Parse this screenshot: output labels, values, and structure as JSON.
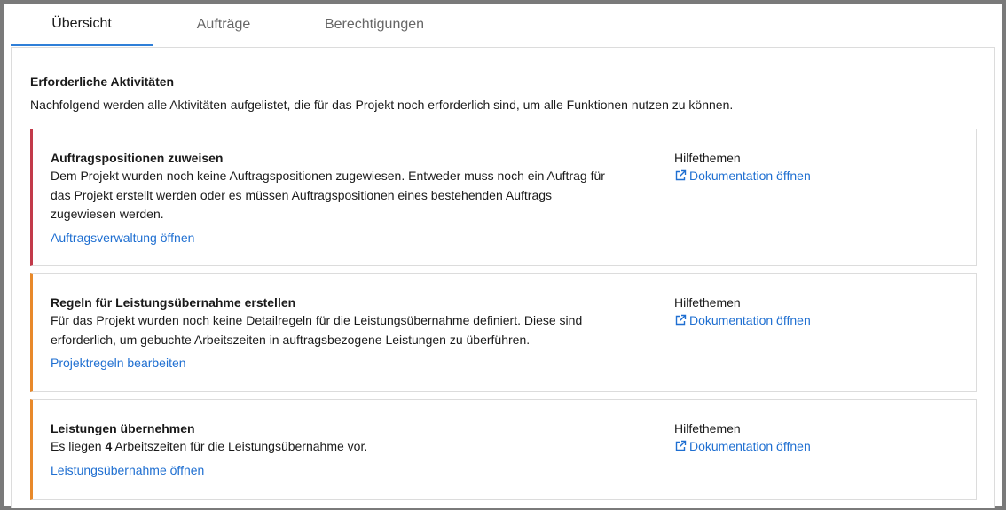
{
  "tabs": [
    {
      "label": "Übersicht",
      "active": true
    },
    {
      "label": "Aufträge",
      "active": false
    },
    {
      "label": "Berechtigungen",
      "active": false
    }
  ],
  "section": {
    "title": "Erforderliche Aktivitäten",
    "description": "Nachfolgend werden alle Aktivitäten aufgelistet, die für das Projekt noch erforderlich sind, um alle Funktionen nutzen zu können."
  },
  "cards": [
    {
      "title": "Auftragspositionen zuweisen",
      "text_line1": "Dem Projekt wurden noch keine Auftragspositionen zugewiesen. Entweder muss noch ein Auftrag für",
      "text_line2": "das Projekt erstellt werden oder es müssen Auftragspositionen eines bestehenden Auftrags",
      "text_line3": "zugewiesen werden.",
      "link": "Auftragsverwaltung öffnen",
      "help_title": "Hilfethemen",
      "help_link": "Dokumentation öffnen",
      "accent": "#c23a4a"
    },
    {
      "title": "Regeln für Leistungsübernahme erstellen",
      "text_line1": "Für das Projekt wurden noch keine Detailregeln für die Leistungsübernahme definiert. Diese sind",
      "text_line2": "erforderlich, um gebuchte Arbeitszeiten in auftragsbezogene Leistungen zu überführen.",
      "link": "Projektregeln bearbeiten",
      "help_title": "Hilfethemen",
      "help_link": "Dokumentation öffnen",
      "accent": "#e8892a"
    },
    {
      "title": "Leistungen übernehmen",
      "text_prefix": "Es liegen ",
      "text_count": "4",
      "text_suffix": " Arbeitszeiten für die Leistungsübernahme vor.",
      "link": "Leistungsübernahme öffnen",
      "help_title": "Hilfethemen",
      "help_link": "Dokumentation öffnen",
      "accent": "#e8892a"
    }
  ],
  "icons": {
    "external_link": "external-link-icon"
  },
  "colors": {
    "link": "#1f6fd1",
    "active_tab": "#2f7fd8"
  }
}
